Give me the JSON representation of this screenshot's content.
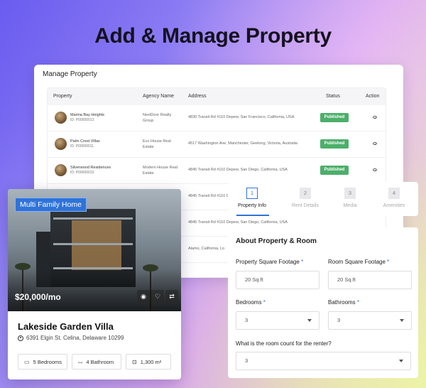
{
  "hero_title": "Add & Manage Property",
  "manage": {
    "title": "Manage Property",
    "columns": [
      "Property",
      "Agency Name",
      "Address",
      "Status",
      "Action"
    ],
    "rows": [
      {
        "name": "Marina Bay Heights",
        "id": "ID: P00000013",
        "agency": "NextDoor Realty Group",
        "address": "4830 Transit Rd #110 Depew, San Francisco, California, USA",
        "status": "Published"
      },
      {
        "name": "Palm Crest Villas",
        "id": "ID: P00000011",
        "agency": "Eco House Real Estate",
        "address": "4517 Washington Ave, Manchester, Geelong, Victoria, Australia",
        "status": "Published"
      },
      {
        "name": "Silverwood Residences",
        "id": "ID: P00000010",
        "agency": "Modern House Real Estate",
        "address": "4845 Transit Rd #110 Depew, San Diego, California, USA",
        "status": "Published"
      },
      {
        "name": "",
        "id": "",
        "agency": "",
        "address": "4845 Transit Rd #110 Depew, San Diego, California, USA",
        "status": ""
      },
      {
        "name": "",
        "id": "",
        "agency": "",
        "address": "4845 Transit Rd #110 Depew, San Diego, California, USA",
        "status": ""
      },
      {
        "name": "",
        "id": "",
        "agency": "",
        "address": "Alamo, California, Lo",
        "status": ""
      }
    ]
  },
  "card": {
    "tag": "Multi Family Home",
    "price": "$20,000/mo",
    "title": "Lakeside Garden Villa",
    "address": "6391 Elgin St. Celina, Delaware 10299",
    "features": [
      {
        "icon": "bed-icon",
        "label": "5 Bedrooms"
      },
      {
        "icon": "bath-icon",
        "label": "4 Bathroom"
      },
      {
        "icon": "area-icon",
        "label": "1,300 m²"
      }
    ]
  },
  "steps": [
    {
      "num": "1",
      "label": "Property Info",
      "active": true
    },
    {
      "num": "2",
      "label": "Rent Details",
      "active": false
    },
    {
      "num": "3",
      "label": "Media",
      "active": false
    },
    {
      "num": "4",
      "label": "Amenities",
      "active": false
    }
  ],
  "form": {
    "title": "About Property & Room",
    "property_sqft_label": "Property Square Footage",
    "property_sqft_value": "20 Sq.ft",
    "room_sqft_label": "Room Square Footage",
    "room_sqft_value": "20 Sq.ft",
    "bedrooms_label": "Bedrooms",
    "bedrooms_value": "3",
    "bathrooms_label": "Bathrooms",
    "bathrooms_value": "3",
    "room_count_label": "What is the room count for the renter?",
    "room_count_value": "3",
    "required_mark": "*"
  },
  "colors": {
    "accent": "#2f73d9",
    "published": "#4caf6a"
  }
}
